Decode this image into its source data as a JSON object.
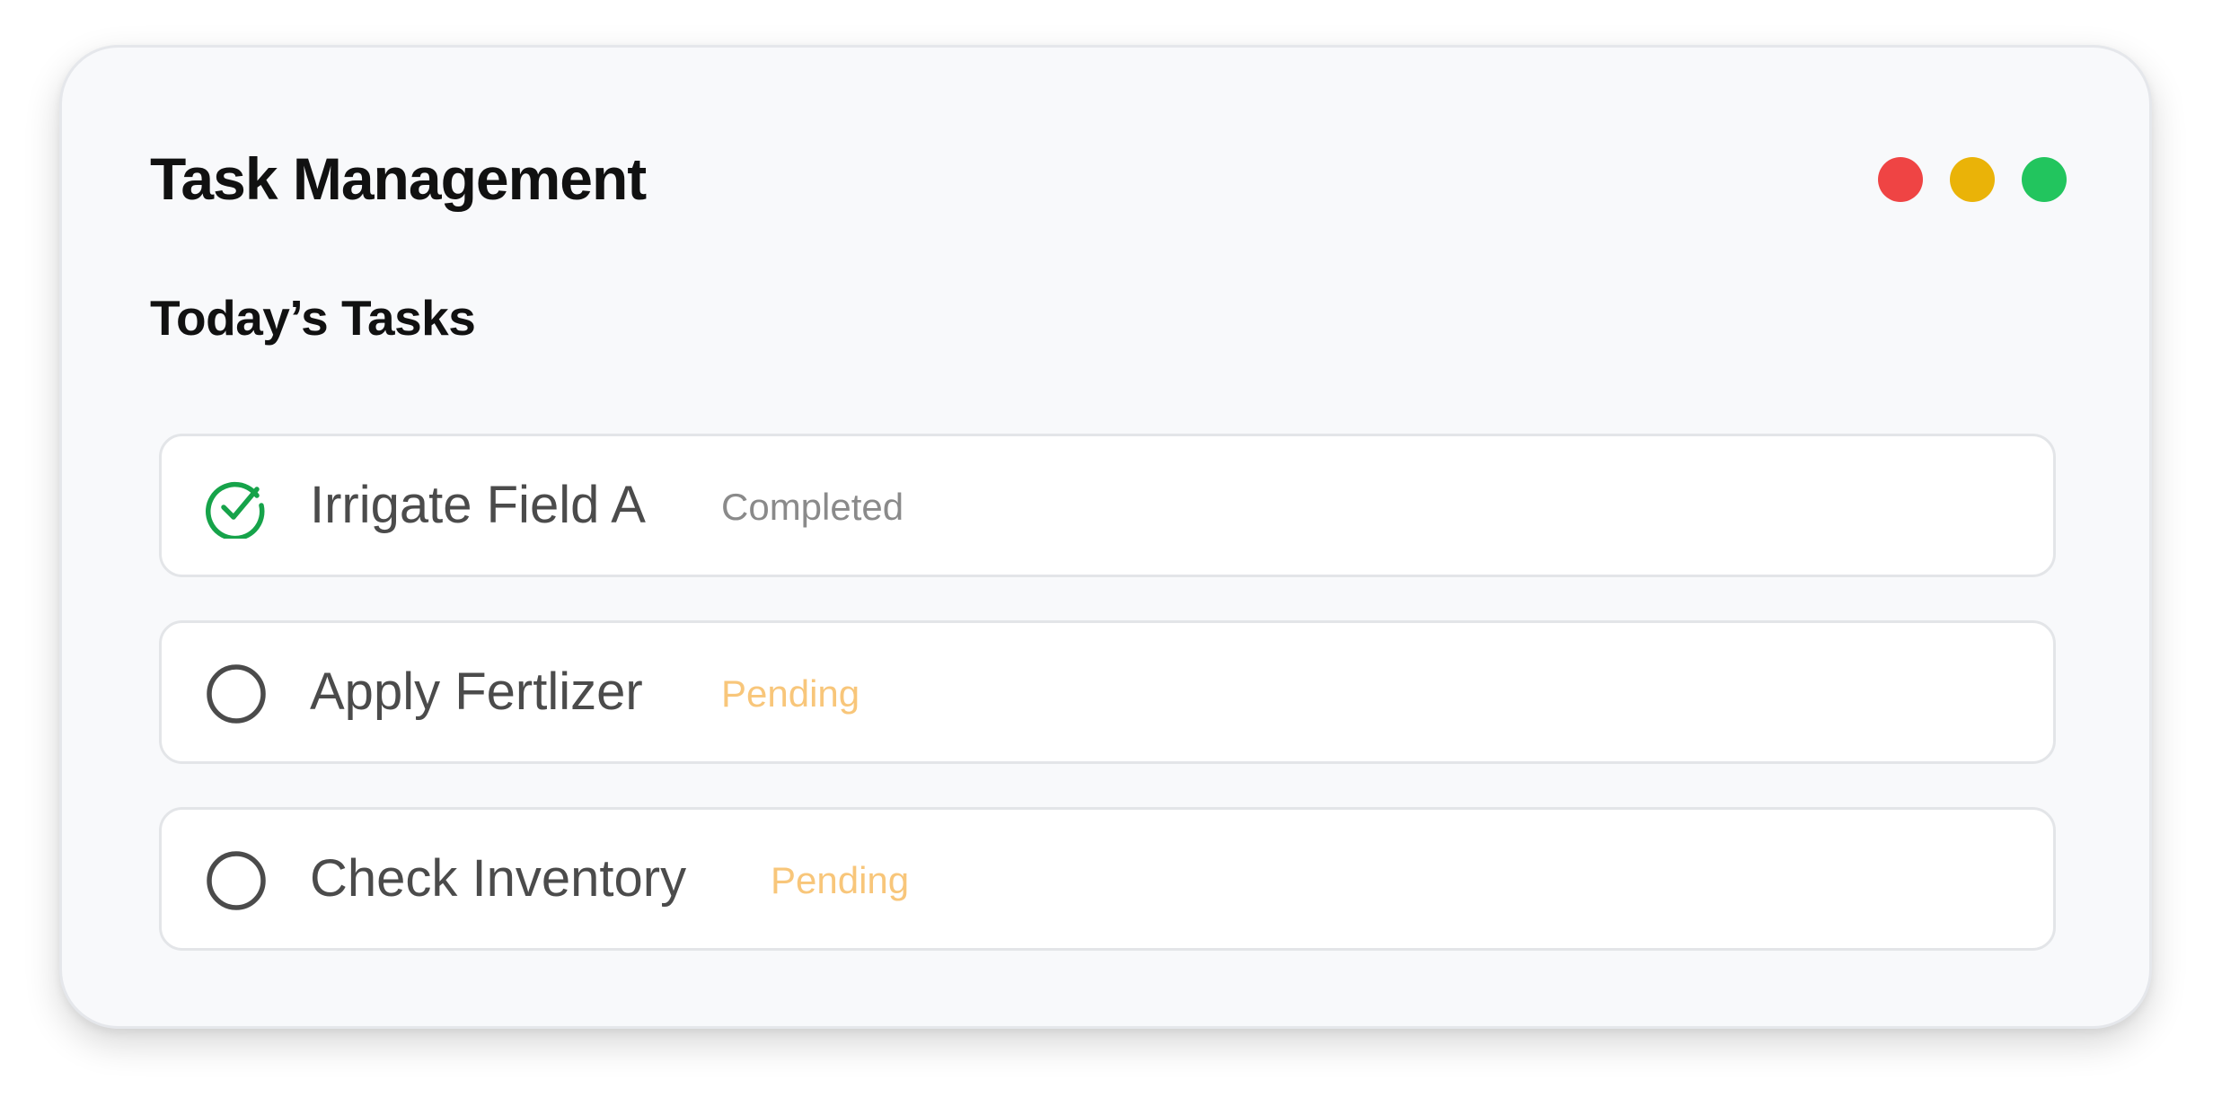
{
  "window": {
    "title": "Task Management",
    "controls": [
      {
        "name": "close",
        "color": "#ef4444"
      },
      {
        "name": "minimize",
        "color": "#eab308"
      },
      {
        "name": "maximize",
        "color": "#22c55e"
      }
    ]
  },
  "section": {
    "title": "Today’s Tasks"
  },
  "tasks": [
    {
      "name": "Irrigate Field A",
      "status": "Completed",
      "icon": "check-circle-icon",
      "status_color": "#8a8a8a",
      "icon_color": "#16a34a"
    },
    {
      "name": "Apply Fertlizer",
      "status": "Pending",
      "icon": "empty-circle-icon",
      "status_color": "#f8c67a",
      "icon_color": "#4b4b4b"
    },
    {
      "name": "Check Inventory",
      "status": "Pending",
      "icon": "empty-circle-icon",
      "status_color": "#f8c67a",
      "icon_color": "#4b4b4b"
    }
  ]
}
